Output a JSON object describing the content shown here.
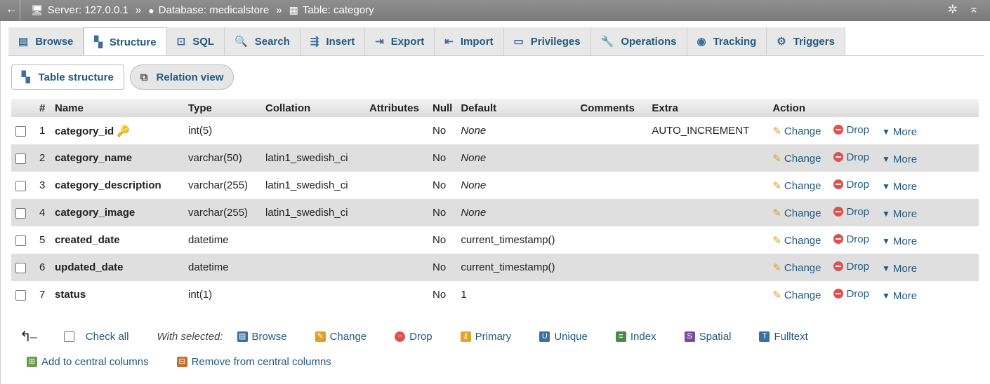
{
  "breadcrumb": {
    "server": "Server: 127.0.0.1",
    "database": "Database: medicalstore",
    "table": "Table: category",
    "separator": "»"
  },
  "tabs": [
    {
      "label": "Browse",
      "icon": "browse-icon"
    },
    {
      "label": "Structure",
      "icon": "structure-icon",
      "active": true
    },
    {
      "label": "SQL",
      "icon": "sql-icon"
    },
    {
      "label": "Search",
      "icon": "search-icon"
    },
    {
      "label": "Insert",
      "icon": "insert-icon"
    },
    {
      "label": "Export",
      "icon": "export-icon"
    },
    {
      "label": "Import",
      "icon": "import-icon"
    },
    {
      "label": "Privileges",
      "icon": "privileges-icon"
    },
    {
      "label": "Operations",
      "icon": "operations-icon"
    },
    {
      "label": "Tracking",
      "icon": "tracking-icon"
    },
    {
      "label": "Triggers",
      "icon": "triggers-icon"
    }
  ],
  "subtabs": [
    {
      "label": "Table structure",
      "icon": "structure-icon"
    },
    {
      "label": "Relation view",
      "icon": "relation-icon"
    }
  ],
  "table": {
    "headers": [
      "#",
      "Name",
      "Type",
      "Collation",
      "Attributes",
      "Null",
      "Default",
      "Comments",
      "Extra",
      "Action"
    ],
    "rows": [
      {
        "num": "1",
        "name": "category_id",
        "type": "int(5)",
        "collation": "",
        "attributes": "",
        "null": "No",
        "default": "None",
        "comments": "",
        "extra": "AUTO_INCREMENT",
        "primary_key": true
      },
      {
        "num": "2",
        "name": "category_name",
        "type": "varchar(50)",
        "collation": "latin1_swedish_ci",
        "attributes": "",
        "null": "No",
        "default": "None",
        "comments": "",
        "extra": ""
      },
      {
        "num": "3",
        "name": "category_description",
        "type": "varchar(255)",
        "collation": "latin1_swedish_ci",
        "attributes": "",
        "null": "No",
        "default": "None",
        "comments": "",
        "extra": ""
      },
      {
        "num": "4",
        "name": "category_image",
        "type": "varchar(255)",
        "collation": "latin1_swedish_ci",
        "attributes": "",
        "null": "No",
        "default": "None",
        "comments": "",
        "extra": ""
      },
      {
        "num": "5",
        "name": "created_date",
        "type": "datetime",
        "collation": "",
        "attributes": "",
        "null": "No",
        "default": "current_timestamp()",
        "comments": "",
        "extra": ""
      },
      {
        "num": "6",
        "name": "updated_date",
        "type": "datetime",
        "collation": "",
        "attributes": "",
        "null": "No",
        "default": "current_timestamp()",
        "comments": "",
        "extra": ""
      },
      {
        "num": "7",
        "name": "status",
        "type": "int(1)",
        "collation": "",
        "attributes": "",
        "null": "No",
        "default": "1",
        "comments": "",
        "extra": ""
      }
    ],
    "actions": {
      "change": "Change",
      "drop": "Drop",
      "more": "More"
    }
  },
  "footer": {
    "check_all": "Check all",
    "with_selected": "With selected:",
    "bulk_actions": [
      {
        "label": "Browse",
        "icon": "browse-icon"
      },
      {
        "label": "Change",
        "icon": "pencil-icon"
      },
      {
        "label": "Drop",
        "icon": "drop-icon"
      },
      {
        "label": "Primary",
        "icon": "key-icon"
      },
      {
        "label": "Unique",
        "icon": "unique-icon"
      },
      {
        "label": "Index",
        "icon": "index-icon"
      },
      {
        "label": "Spatial",
        "icon": "spatial-icon"
      },
      {
        "label": "Fulltext",
        "icon": "fulltext-icon"
      }
    ],
    "central": [
      {
        "label": "Add to central columns",
        "icon": "add-central-icon"
      },
      {
        "label": "Remove from central columns",
        "icon": "remove-central-icon"
      }
    ]
  }
}
